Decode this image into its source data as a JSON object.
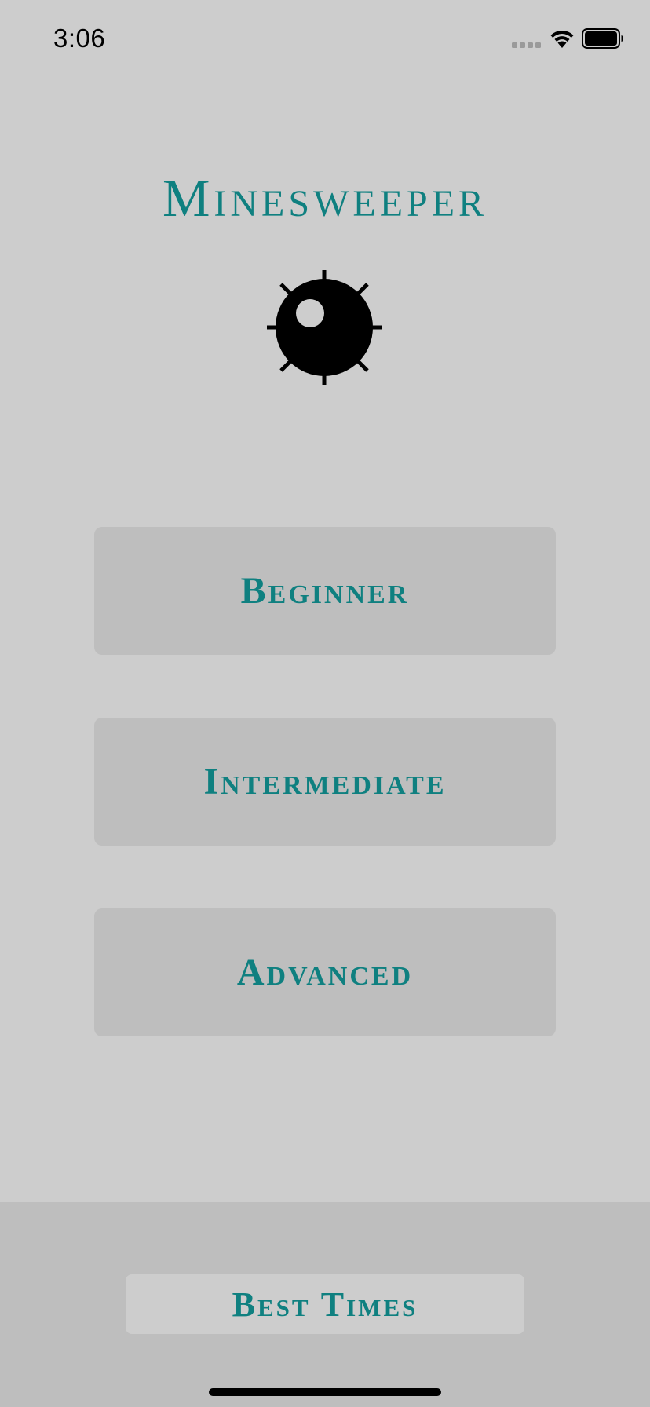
{
  "status_bar": {
    "time": "3:06",
    "signal_icon": "cellular-signal-icon",
    "wifi_icon": "wifi-icon",
    "battery_icon": "battery-icon"
  },
  "app": {
    "title": "Minesweeper",
    "logo_icon": "mine-icon"
  },
  "levels": [
    {
      "label": "Beginner"
    },
    {
      "label": "Intermediate"
    },
    {
      "label": "Advanced"
    }
  ],
  "footer": {
    "best_times_label": "Best Times"
  },
  "colors": {
    "accent": "#0f8080",
    "background": "#cdcdcd",
    "button_background": "#bebebe"
  }
}
